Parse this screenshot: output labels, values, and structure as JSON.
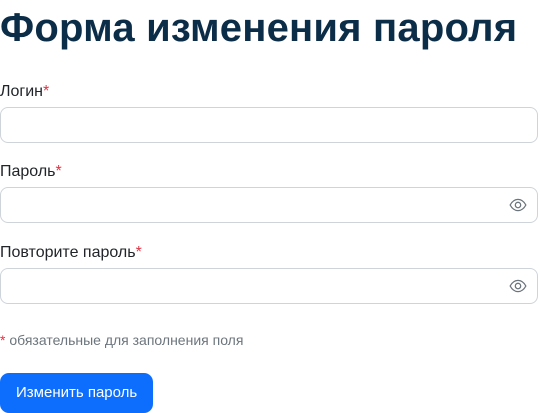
{
  "form": {
    "title": "Форма изменения пароля",
    "required_mark": "*",
    "fields": [
      {
        "label": "Логин",
        "value": "",
        "placeholder": "",
        "type": "text"
      },
      {
        "label": "Пароль",
        "value": "",
        "placeholder": "",
        "type": "password",
        "toggle_icon": "eye-icon"
      },
      {
        "label": "Повторите пароль",
        "value": "",
        "placeholder": "",
        "type": "password",
        "toggle_icon": "eye-icon"
      }
    ],
    "required_note": "обязательные для заполнения поля",
    "submit_label": "Изменить пароль"
  },
  "colors": {
    "title": "#0c2d48",
    "required": "#dc3545",
    "button_bg": "#0d6efd",
    "button_text": "#ffffff",
    "border": "#ced4da",
    "note_text": "#6c757d"
  }
}
